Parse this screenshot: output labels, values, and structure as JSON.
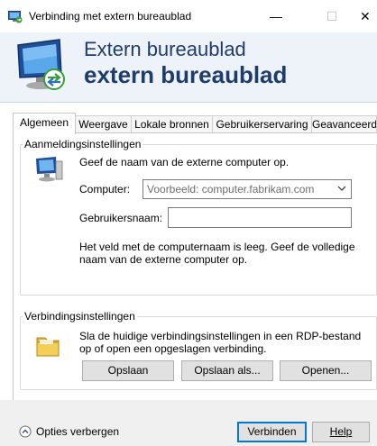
{
  "window": {
    "title": "Verbinding met extern bureaublad",
    "minimize_glyph": "—",
    "maximize_glyph": "☐",
    "close_glyph": "✕"
  },
  "banner": {
    "line1": "Extern bureaublad",
    "line2": "extern bureaublad"
  },
  "tabs": [
    "Algemeen",
    "Weergave",
    "Lokale bronnen",
    "Gebruikerservaring",
    "Geavanceerd"
  ],
  "logon": {
    "legend": "Aanmeldingsinstellingen",
    "intro": "Geef de naam van de externe computer op.",
    "computer_label": "Computer:",
    "computer_placeholder": "Voorbeeld: computer.fabrikam.com",
    "user_label": "Gebruikersnaam:",
    "user_value": "",
    "hint": "Het veld met de computernaam is leeg. Geef de volledige naam van de externe computer op."
  },
  "connection": {
    "legend": "Verbindingsinstellingen",
    "description": "Sla de huidige verbindingsinstellingen in een RDP-bestand op of open een opgeslagen verbinding.",
    "save": "Opslaan",
    "save_as": "Opslaan als...",
    "open": "Openen..."
  },
  "footer": {
    "options": "Opties verbergen",
    "connect": "Verbinden",
    "help": "Help"
  },
  "colors": {
    "banner_text": "#1f3d6b",
    "banner_bg": "#eef3fa",
    "accent": "#0078d7"
  }
}
